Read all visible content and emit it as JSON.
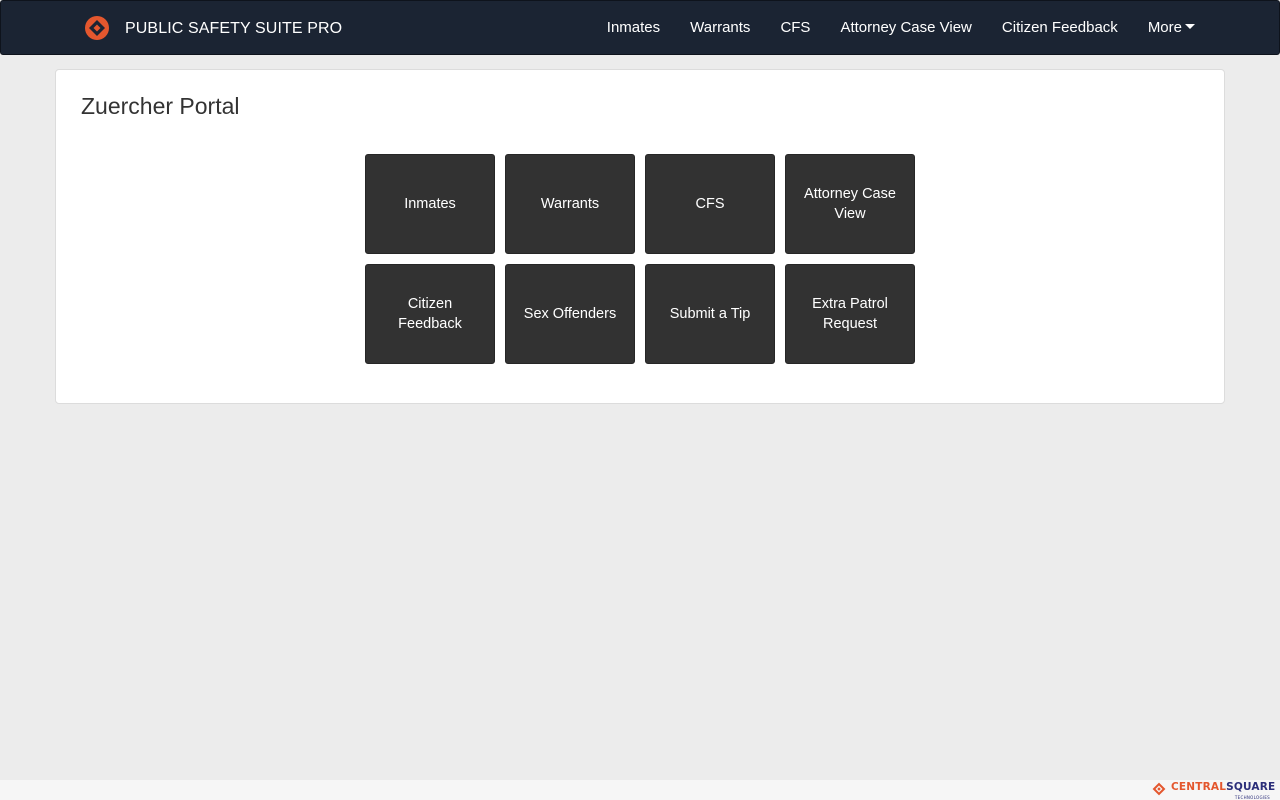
{
  "brand": {
    "title": "PUBLIC SAFETY SUITE PRO",
    "logo_icon": "centralsquare-diamond-icon",
    "accent_color": "#e4572e"
  },
  "nav": {
    "items": [
      {
        "label": "Inmates"
      },
      {
        "label": "Warrants"
      },
      {
        "label": "CFS"
      },
      {
        "label": "Attorney Case View"
      },
      {
        "label": "Citizen Feedback"
      }
    ],
    "more_label": "More",
    "more_icon": "caret-down-icon",
    "background_color": "#1b2433"
  },
  "main": {
    "title": "Zuercher Portal",
    "tiles": [
      {
        "label": "Inmates"
      },
      {
        "label": "Warrants"
      },
      {
        "label": "CFS"
      },
      {
        "label": "Attorney Case View"
      },
      {
        "label": "Citizen Feedback"
      },
      {
        "label": "Sex Offenders"
      },
      {
        "label": "Submit a Tip"
      },
      {
        "label": "Extra Patrol Request"
      }
    ],
    "tile_color": "#323232"
  },
  "footer": {
    "logo_part1": "CENTRAL",
    "logo_part2": "SQUARE",
    "logo_sub": "TECHNOLOGIES",
    "logo_icon": "centralsquare-diamond-icon"
  }
}
